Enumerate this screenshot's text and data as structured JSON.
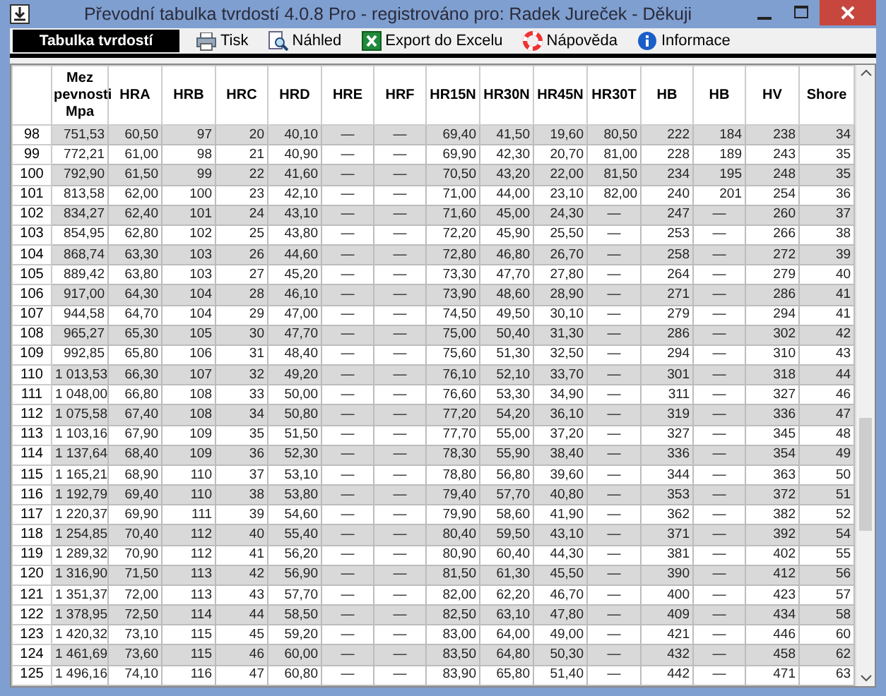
{
  "window": {
    "title": "Převodní tabulka tvrdostí 4.0.8 Pro - registrováno pro: Radek Jureček - Děkuji"
  },
  "toolbar": [
    {
      "kind": "tab",
      "label": "Tabulka tvrdostí",
      "selected": true
    },
    {
      "kind": "print",
      "label": "Tisk"
    },
    {
      "kind": "preview",
      "label": "Náhled"
    },
    {
      "kind": "excel",
      "label": "Export do Excelu"
    },
    {
      "kind": "help",
      "label": "Nápověda"
    },
    {
      "kind": "info",
      "label": "Informace"
    }
  ],
  "table": {
    "columns": [
      "",
      "Mez pevnosti Mpa",
      "HRA",
      "HRB",
      "HRC",
      "HRD",
      "HRE",
      "HRF",
      "HR15N",
      "HR30N",
      "HR45N",
      "HR30T",
      "HB",
      "HB",
      "HV",
      "Shore"
    ],
    "rows": [
      {
        "shaded": true,
        "cells": [
          "98",
          "751,53",
          "60,50",
          "97",
          "20",
          "40,10",
          "—",
          "—",
          "69,40",
          "41,50",
          "19,60",
          "80,50",
          "222",
          "184",
          "238",
          "34"
        ]
      },
      {
        "shaded": false,
        "cells": [
          "99",
          "772,21",
          "61,00",
          "98",
          "21",
          "40,90",
          "—",
          "—",
          "69,90",
          "42,30",
          "20,70",
          "81,00",
          "228",
          "189",
          "243",
          "35"
        ]
      },
      {
        "shaded": true,
        "cells": [
          "100",
          "792,90",
          "61,50",
          "99",
          "22",
          "41,60",
          "—",
          "—",
          "70,50",
          "43,20",
          "22,00",
          "81,50",
          "234",
          "195",
          "248",
          "35"
        ]
      },
      {
        "shaded": false,
        "cells": [
          "101",
          "813,58",
          "62,00",
          "100",
          "23",
          "42,10",
          "—",
          "—",
          "71,00",
          "44,00",
          "23,10",
          "82,00",
          "240",
          "201",
          "254",
          "36"
        ]
      },
      {
        "shaded": true,
        "cells": [
          "102",
          "834,27",
          "62,40",
          "101",
          "24",
          "43,10",
          "—",
          "—",
          "71,60",
          "45,00",
          "24,30",
          "—",
          "247",
          "—",
          "260",
          "37"
        ]
      },
      {
        "shaded": false,
        "cells": [
          "103",
          "854,95",
          "62,80",
          "102",
          "25",
          "43,80",
          "—",
          "—",
          "72,20",
          "45,90",
          "25,50",
          "—",
          "253",
          "—",
          "266",
          "38"
        ]
      },
      {
        "shaded": true,
        "cells": [
          "104",
          "868,74",
          "63,30",
          "103",
          "26",
          "44,60",
          "—",
          "—",
          "72,80",
          "46,80",
          "26,70",
          "—",
          "258",
          "—",
          "272",
          "39"
        ]
      },
      {
        "shaded": false,
        "cells": [
          "105",
          "889,42",
          "63,80",
          "103",
          "27",
          "45,20",
          "—",
          "—",
          "73,30",
          "47,70",
          "27,80",
          "—",
          "264",
          "—",
          "279",
          "40"
        ]
      },
      {
        "shaded": true,
        "cells": [
          "106",
          "917,00",
          "64,30",
          "104",
          "28",
          "46,10",
          "—",
          "—",
          "73,90",
          "48,60",
          "28,90",
          "—",
          "271",
          "—",
          "286",
          "41"
        ]
      },
      {
        "shaded": false,
        "cells": [
          "107",
          "944,58",
          "64,70",
          "104",
          "29",
          "47,00",
          "—",
          "—",
          "74,50",
          "49,50",
          "30,10",
          "—",
          "279",
          "—",
          "294",
          "41"
        ]
      },
      {
        "shaded": true,
        "cells": [
          "108",
          "965,27",
          "65,30",
          "105",
          "30",
          "47,70",
          "—",
          "—",
          "75,00",
          "50,40",
          "31,30",
          "—",
          "286",
          "—",
          "302",
          "42"
        ]
      },
      {
        "shaded": false,
        "cells": [
          "109",
          "992,85",
          "65,80",
          "106",
          "31",
          "48,40",
          "—",
          "—",
          "75,60",
          "51,30",
          "32,50",
          "—",
          "294",
          "—",
          "310",
          "43"
        ]
      },
      {
        "shaded": true,
        "cells": [
          "110",
          "1 013,53",
          "66,30",
          "107",
          "32",
          "49,20",
          "—",
          "—",
          "76,10",
          "52,10",
          "33,70",
          "—",
          "301",
          "—",
          "318",
          "44"
        ]
      },
      {
        "shaded": false,
        "cells": [
          "111",
          "1 048,00",
          "66,80",
          "108",
          "33",
          "50,00",
          "—",
          "—",
          "76,60",
          "53,30",
          "34,90",
          "—",
          "311",
          "—",
          "327",
          "46"
        ]
      },
      {
        "shaded": true,
        "cells": [
          "112",
          "1 075,58",
          "67,40",
          "108",
          "34",
          "50,80",
          "—",
          "—",
          "77,20",
          "54,20",
          "36,10",
          "—",
          "319",
          "—",
          "336",
          "47"
        ]
      },
      {
        "shaded": false,
        "cells": [
          "113",
          "1 103,16",
          "67,90",
          "109",
          "35",
          "51,50",
          "—",
          "—",
          "77,70",
          "55,00",
          "37,20",
          "—",
          "327",
          "—",
          "345",
          "48"
        ]
      },
      {
        "shaded": true,
        "cells": [
          "114",
          "1 137,64",
          "68,40",
          "109",
          "36",
          "52,30",
          "—",
          "—",
          "78,30",
          "55,90",
          "38,40",
          "—",
          "336",
          "—",
          "354",
          "49"
        ]
      },
      {
        "shaded": false,
        "cells": [
          "115",
          "1 165,21",
          "68,90",
          "110",
          "37",
          "53,10",
          "—",
          "—",
          "78,80",
          "56,80",
          "39,60",
          "—",
          "344",
          "—",
          "363",
          "50"
        ]
      },
      {
        "shaded": true,
        "cells": [
          "116",
          "1 192,79",
          "69,40",
          "110",
          "38",
          "53,80",
          "—",
          "—",
          "79,40",
          "57,70",
          "40,80",
          "—",
          "353",
          "—",
          "372",
          "51"
        ]
      },
      {
        "shaded": false,
        "cells": [
          "117",
          "1 220,37",
          "69,90",
          "111",
          "39",
          "54,60",
          "—",
          "—",
          "79,90",
          "58,60",
          "41,90",
          "—",
          "362",
          "—",
          "382",
          "52"
        ]
      },
      {
        "shaded": true,
        "cells": [
          "118",
          "1 254,85",
          "70,40",
          "112",
          "40",
          "55,40",
          "—",
          "—",
          "80,40",
          "59,50",
          "43,10",
          "—",
          "371",
          "—",
          "392",
          "54"
        ]
      },
      {
        "shaded": false,
        "cells": [
          "119",
          "1 289,32",
          "70,90",
          "112",
          "41",
          "56,20",
          "—",
          "—",
          "80,90",
          "60,40",
          "44,30",
          "—",
          "381",
          "—",
          "402",
          "55"
        ]
      },
      {
        "shaded": true,
        "cells": [
          "120",
          "1 316,90",
          "71,50",
          "113",
          "42",
          "56,90",
          "—",
          "—",
          "81,50",
          "61,30",
          "45,50",
          "—",
          "390",
          "—",
          "412",
          "56"
        ]
      },
      {
        "shaded": false,
        "cells": [
          "121",
          "1 351,37",
          "72,00",
          "113",
          "43",
          "57,70",
          "—",
          "—",
          "82,00",
          "62,20",
          "46,70",
          "—",
          "400",
          "—",
          "423",
          "57"
        ]
      },
      {
        "shaded": true,
        "cells": [
          "122",
          "1 378,95",
          "72,50",
          "114",
          "44",
          "58,50",
          "—",
          "—",
          "82,50",
          "63,10",
          "47,80",
          "—",
          "409",
          "—",
          "434",
          "58"
        ]
      },
      {
        "shaded": false,
        "cells": [
          "123",
          "1 420,32",
          "73,10",
          "115",
          "45",
          "59,20",
          "—",
          "—",
          "83,00",
          "64,00",
          "49,00",
          "—",
          "421",
          "—",
          "446",
          "60"
        ]
      },
      {
        "shaded": true,
        "cells": [
          "124",
          "1 461,69",
          "73,60",
          "115",
          "46",
          "60,00",
          "—",
          "—",
          "83,50",
          "64,80",
          "50,30",
          "—",
          "432",
          "—",
          "458",
          "62"
        ]
      },
      {
        "shaded": false,
        "cells": [
          "125",
          "1 496,16",
          "74,10",
          "116",
          "47",
          "60,80",
          "—",
          "—",
          "83,90",
          "65,80",
          "51,40",
          "—",
          "442",
          "—",
          "471",
          "63"
        ]
      }
    ]
  }
}
